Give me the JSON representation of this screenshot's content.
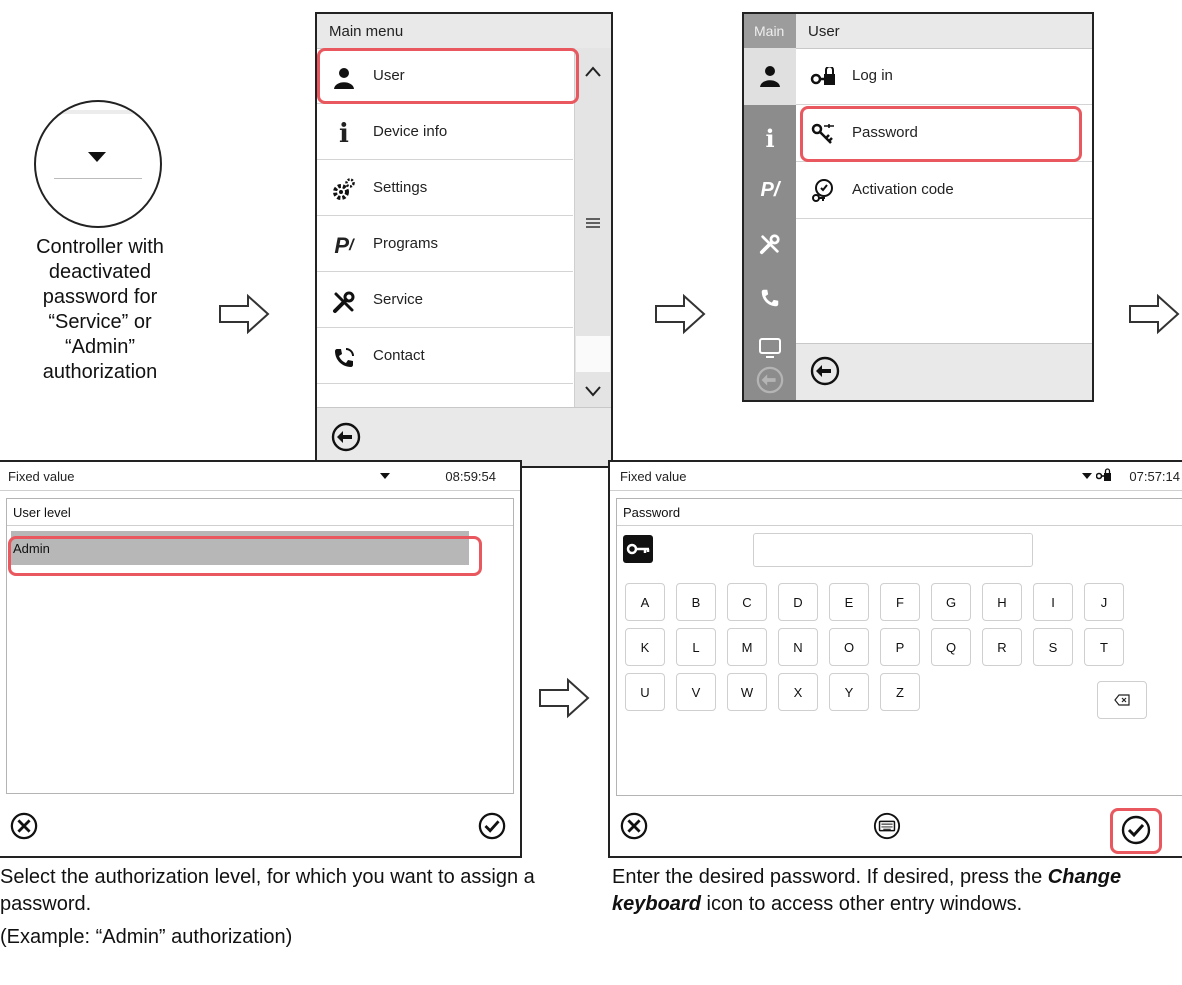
{
  "controller": {
    "caption": "Controller with\ndeactivated\npassword for\n“Service” or\n“Admin”\nauthorization"
  },
  "main_menu": {
    "title": "Main menu",
    "items": [
      {
        "label": "User",
        "icon": "user-icon"
      },
      {
        "label": "Device info",
        "icon": "info-icon"
      },
      {
        "label": "Settings",
        "icon": "gears-icon"
      },
      {
        "label": "Programs",
        "icon": "programs-icon"
      },
      {
        "label": "Service",
        "icon": "service-tools-icon"
      },
      {
        "label": "Contact",
        "icon": "phone-icon"
      }
    ],
    "highlighted": "User"
  },
  "user_menu": {
    "side_label": "Main",
    "title": "User",
    "items": [
      {
        "label": "Log in",
        "icon": "login-key-icon"
      },
      {
        "label": "Password",
        "icon": "password-key-icon"
      },
      {
        "label": "Activation code",
        "icon": "activation-code-icon"
      }
    ],
    "highlighted": "Password"
  },
  "user_level_screen": {
    "mode": "Fixed value",
    "time": "08:59:54",
    "section_title": "User level",
    "options": [
      "Admin"
    ],
    "selected": "Admin"
  },
  "password_screen": {
    "mode": "Fixed value",
    "time": "07:57:14",
    "section_title": "Password",
    "password_value": "",
    "keys": [
      [
        "A",
        "B",
        "C",
        "D",
        "E",
        "F",
        "G",
        "H",
        "I",
        "J"
      ],
      [
        "K",
        "L",
        "M",
        "N",
        "O",
        "P",
        "Q",
        "R",
        "S",
        "T"
      ],
      [
        "U",
        "V",
        "W",
        "X",
        "Y",
        "Z"
      ]
    ]
  },
  "descriptions": {
    "left_1": "Select the authorization level, for which you want to assign a password.",
    "left_2": "(Example: “Admin” authorization)",
    "right_1": "Enter the desired password. If desired, press the",
    "right_bold": "Change keyboard",
    "right_2": " icon to access other entry windows."
  },
  "colors": {
    "highlight": "#e8585e",
    "sidebar": "#8c8c8c",
    "header": "#e9e9e9"
  }
}
